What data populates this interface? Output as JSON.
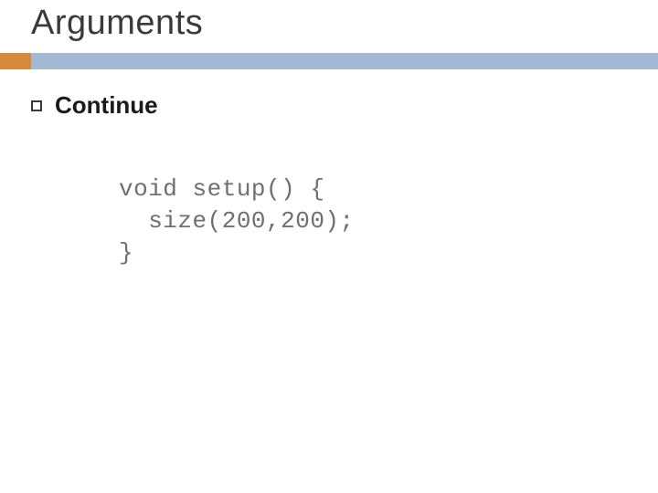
{
  "title": "Arguments",
  "bullet": "Continue",
  "code": {
    "line1": "void setup() {",
    "line2": "  size(200,200);",
    "line3": "}"
  }
}
